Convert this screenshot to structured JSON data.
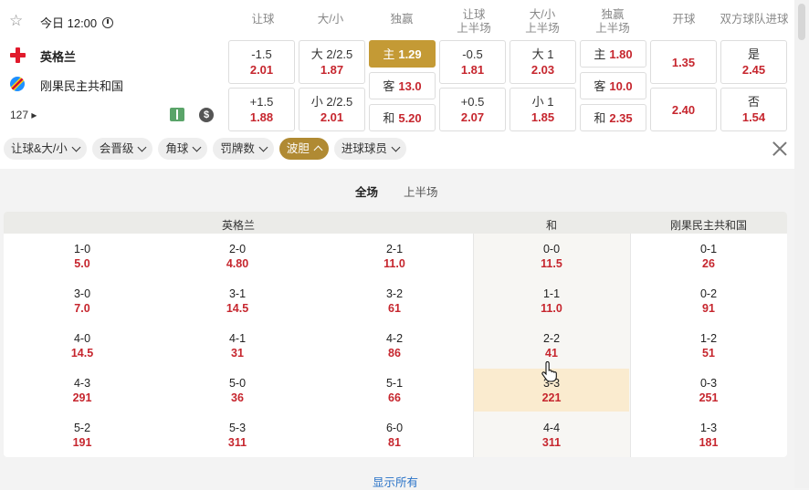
{
  "header": {
    "time": "今日 12:00"
  },
  "columns": [
    "让球",
    "大/小",
    "独赢",
    "让球\n上半场",
    "大/小\n上半场",
    "独赢\n上半场",
    "开球",
    "双方球队进球"
  ],
  "teams": {
    "home": "英格兰",
    "away": "刚果民主共和国",
    "more": "127 ▸"
  },
  "icons": {
    "dollar": "$"
  },
  "odds": {
    "hcap": [
      {
        "line": "-1.5",
        "odds": "2.01"
      },
      {
        "line": "+1.5",
        "odds": "1.88"
      }
    ],
    "ou": [
      {
        "line": "大 2/2.5",
        "odds": "1.87"
      },
      {
        "line": "小 2/2.5",
        "odds": "2.01"
      }
    ],
    "ml": [
      {
        "line": "主",
        "odds": "1.29"
      },
      {
        "line": "客",
        "odds": "13.0"
      },
      {
        "line": "和",
        "odds": "5.20"
      }
    ],
    "hcap_h1": [
      {
        "line": "-0.5",
        "odds": "1.81"
      },
      {
        "line": "+0.5",
        "odds": "2.07"
      }
    ],
    "ou_h1": [
      {
        "line": "大 1",
        "odds": "2.03"
      },
      {
        "line": "小 1",
        "odds": "1.85"
      }
    ],
    "ml_h1": [
      {
        "line": "主",
        "odds": "1.80"
      },
      {
        "line": "客",
        "odds": "10.0"
      },
      {
        "line": "和",
        "odds": "2.35"
      }
    ],
    "kickoff": [
      "1.35",
      "2.40"
    ],
    "btts": [
      {
        "line": "是",
        "odds": "2.45"
      },
      {
        "line": "否",
        "odds": "1.54"
      }
    ]
  },
  "filters": [
    "让球&大/小",
    "会晋级",
    "角球",
    "罚牌数",
    "波胆",
    "进球球员"
  ],
  "periods": {
    "full": "全场",
    "half": "上半场"
  },
  "grid": {
    "headers": {
      "home": "英格兰",
      "draw": "和",
      "away": "刚果民主共和国"
    },
    "cols": [
      [
        {
          "s": "1-0",
          "o": "5.0"
        },
        {
          "s": "3-0",
          "o": "7.0"
        },
        {
          "s": "4-0",
          "o": "14.5"
        },
        {
          "s": "4-3",
          "o": "291"
        },
        {
          "s": "5-2",
          "o": "191"
        }
      ],
      [
        {
          "s": "2-0",
          "o": "4.80"
        },
        {
          "s": "3-1",
          "o": "14.5"
        },
        {
          "s": "4-1",
          "o": "31"
        },
        {
          "s": "5-0",
          "o": "36"
        },
        {
          "s": "5-3",
          "o": "311"
        }
      ],
      [
        {
          "s": "2-1",
          "o": "11.0"
        },
        {
          "s": "3-2",
          "o": "61"
        },
        {
          "s": "4-2",
          "o": "86"
        },
        {
          "s": "5-1",
          "o": "66"
        },
        {
          "s": "6-0",
          "o": "81"
        }
      ],
      [
        {
          "s": "0-0",
          "o": "11.5"
        },
        {
          "s": "1-1",
          "o": "11.0"
        },
        {
          "s": "2-2",
          "o": "41"
        },
        {
          "s": "3-3",
          "o": "221"
        },
        {
          "s": "4-4",
          "o": "311"
        }
      ],
      [
        {
          "s": "0-1",
          "o": "26"
        },
        {
          "s": "0-2",
          "o": "91"
        },
        {
          "s": "1-2",
          "o": "51"
        },
        {
          "s": "0-3",
          "o": "251"
        },
        {
          "s": "1-3",
          "o": "181"
        }
      ]
    ]
  },
  "show_all": "显示所有"
}
